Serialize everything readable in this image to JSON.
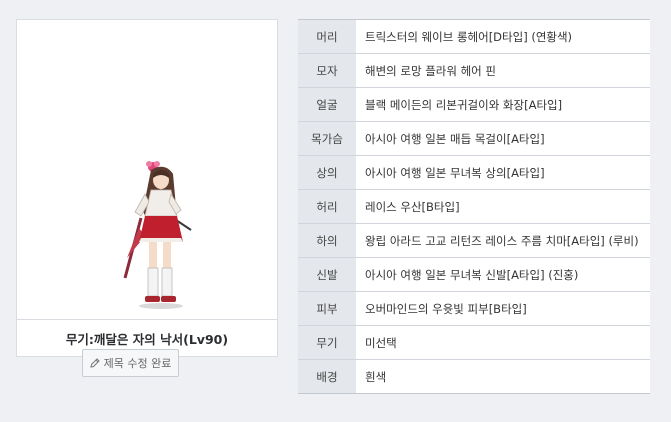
{
  "avatar_title": "무기:깨달은 자의 낙서(Lv90)",
  "edit_button_label": "제목 수정 완료",
  "equipment": [
    {
      "slot": "머리",
      "item": "트릭스터의 웨이브 롱헤어[D타입] (연황색)"
    },
    {
      "slot": "모자",
      "item": "해변의 로망 플라워 헤어 핀"
    },
    {
      "slot": "얼굴",
      "item": "블랙 메이든의 리본귀걸이와 화장[A타입]"
    },
    {
      "slot": "목가슴",
      "item": "아시아 여행 일본 매듭 목걸이[A타입]"
    },
    {
      "slot": "상의",
      "item": "아시아 여행 일본 무녀복 상의[A타입]"
    },
    {
      "slot": "허리",
      "item": "레이스 우산[B타입]"
    },
    {
      "slot": "하의",
      "item": "왕립 아라드 고교 리턴즈 레이스 주름 치마[A타입] (루비)"
    },
    {
      "slot": "신발",
      "item": "아시아 여행 일본 무녀복 신발[A타입] (진홍)"
    },
    {
      "slot": "피부",
      "item": "오버마인드의 우윳빛 피부[B타입]"
    },
    {
      "slot": "무기",
      "item": "미선택"
    },
    {
      "slot": "배경",
      "item": "흰색"
    }
  ],
  "icons": {
    "edit": "pencil-icon"
  }
}
